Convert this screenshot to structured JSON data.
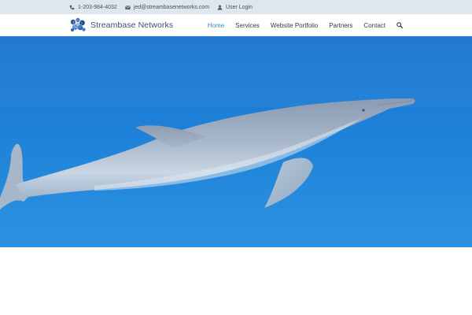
{
  "topbar": {
    "phone": "1-203-984-4032",
    "email": "jed@streambasenetworks.com",
    "login": "User Login"
  },
  "brand": {
    "name": "Streambase Networks"
  },
  "nav": {
    "items": [
      {
        "label": "Home",
        "active": true
      },
      {
        "label": "Services"
      },
      {
        "label": "Website Portfolio"
      },
      {
        "label": "Partners"
      },
      {
        "label": "Contact"
      }
    ],
    "search_icon": "search-icon"
  },
  "hero": {
    "image": "dolphin swimming underwater",
    "colors": {
      "water_top": "#1d7fd6",
      "water_bottom": "#2b90e0"
    }
  },
  "icons": [
    "phone-icon",
    "envelope-icon",
    "user-icon",
    "search-icon"
  ]
}
